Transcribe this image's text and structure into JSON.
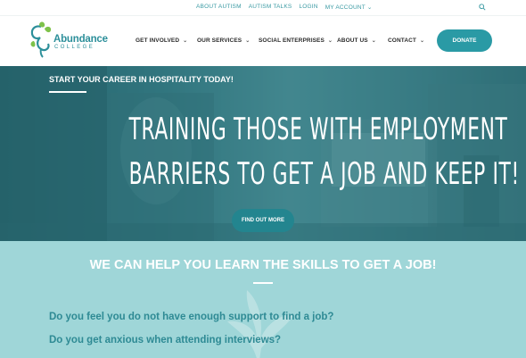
{
  "topbar": {
    "links": [
      "ABOUT AUTISM",
      "AUTISM TALKS",
      "LOGIN",
      "MY ACCOUNT"
    ],
    "search_icon": "search-icon"
  },
  "header": {
    "logo_name": "Abundance",
    "logo_sub": "COLLEGE",
    "nav": [
      {
        "label": "GET INVOLVED"
      },
      {
        "label": "OUR SERVICES"
      },
      {
        "label": "SOCIAL ENTERPRISES"
      },
      {
        "label": "ABOUT US"
      },
      {
        "label": "CONTACT"
      }
    ],
    "donate_label": "DONATE"
  },
  "hero": {
    "tagline": "START YOUR CAREER IN HOSPITALITY TODAY!",
    "headline_line1": "TRAINING THOSE WITH EMPLOYMENT",
    "headline_line2": "BARRIERS TO GET A JOB AND KEEP IT!",
    "cta_label": "FIND OUT MORE"
  },
  "section": {
    "heading": "WE CAN HELP YOU LEARN THE SKILLS TO GET A JOB!",
    "questions": [
      "Do you feel you do not have enough support to find a job?",
      "Do you get anxious when attending interviews?"
    ]
  },
  "colors": {
    "brand_teal": "#2a9aa5",
    "section_bg": "#9fd6d8",
    "question_text": "#2e8a94"
  }
}
